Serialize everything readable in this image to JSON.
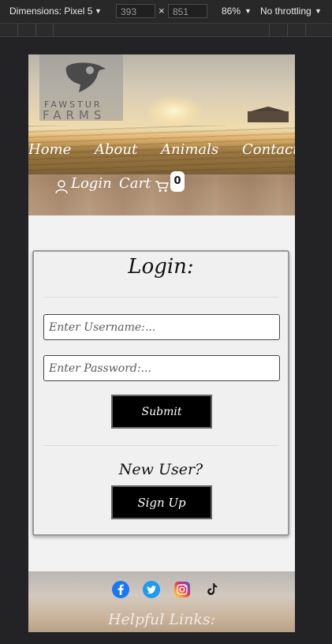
{
  "devtools": {
    "dimensions_label": "Dimensions: Pixel 5",
    "width": "393",
    "height": "851",
    "times": "×",
    "zoom": "86%",
    "throttling": "No throttling",
    "arrow": "▼"
  },
  "site": {
    "logo_line1": "FAWSTUR",
    "logo_line2": "FARMS",
    "nav": {
      "home": "Home",
      "about": "About",
      "animals": "Animals",
      "contact": "Contact"
    },
    "login_link": "Login",
    "cart_link": "Cart",
    "cart_count": "0"
  },
  "login_form": {
    "title": "Login:",
    "username_placeholder": "Enter Username:...",
    "password_placeholder": "Enter Password:...",
    "submit_label": "Submit",
    "new_user_text": "New User?",
    "signup_label": "Sign Up"
  },
  "footer": {
    "social_icons": [
      "facebook-icon",
      "twitter-icon",
      "instagram-icon",
      "tiktok-icon"
    ],
    "helpful_links_heading": "Helpful Links:"
  },
  "colors": {
    "page_background": "#f2f2f2",
    "button_background": "#000000",
    "devtools_background": "#282828"
  }
}
